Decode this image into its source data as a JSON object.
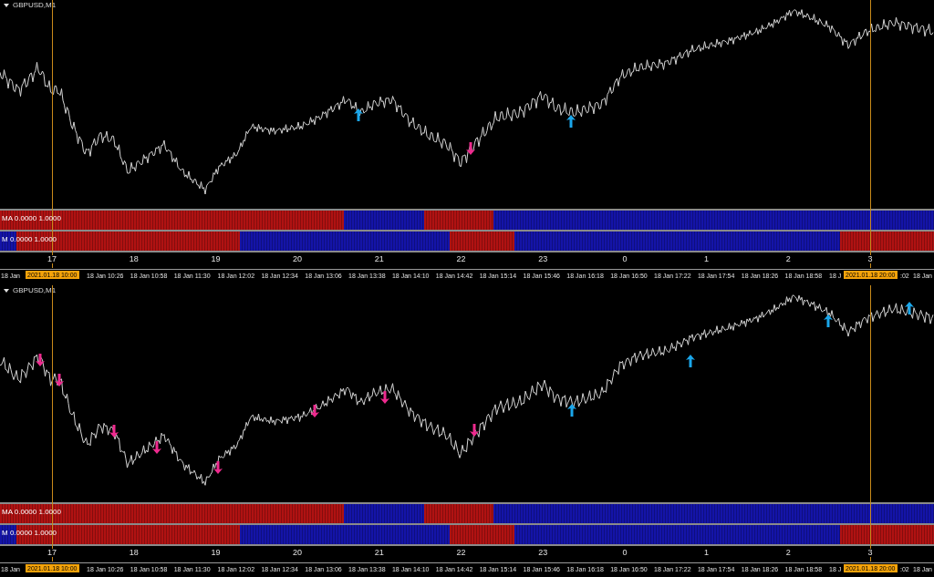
{
  "panels": [
    {
      "title": "GBPUSD,M1",
      "signals": [
        {
          "kind": "up"
        },
        {
          "kind": "down"
        },
        {
          "kind": "up"
        }
      ],
      "indicators": [
        {
          "label": "MA 0.0000 1.0000",
          "segments": [
            {
              "color": "#b01212"
            },
            {
              "color": "#1414a8"
            },
            {
              "color": "#b01212"
            },
            {
              "color": "#1414a8"
            }
          ]
        },
        {
          "label": "M 0.0000 1.0000",
          "segments": [
            {
              "color": "#1414a8"
            },
            {
              "color": "#b01212"
            },
            {
              "color": "#1414a8"
            },
            {
              "color": "#b01212"
            },
            {
              "color": "#1414a8"
            },
            {
              "color": "#b01212"
            }
          ]
        }
      ],
      "hour_labels": [
        "17",
        "18",
        "19",
        "20",
        "21",
        "22",
        "23",
        "0",
        "1",
        "2",
        "3"
      ],
      "time_labels": [
        "18 Jan",
        "18 Jan 10:26",
        "18 Jan 10:58",
        "18 Jan 11:30",
        "18 Jan 12:02",
        "18 Jan 12:34",
        "18 Jan 13:06",
        "18 Jan 13:38",
        "18 Jan 14:10",
        "18 Jan 14:42",
        "18 Jan 15:14",
        "18 Jan 15:46",
        "18 Jan 16:18",
        "18 Jan 16:50",
        "18 Jan 17:22",
        "18 Jan 17:54",
        "18 Jan 18:26",
        "18 Jan 18:58",
        "18 J",
        ":02",
        "18 Jan"
      ],
      "cursor_labels": [
        "2021.01.18 10:00",
        "2021.01.18 20:00"
      ]
    },
    {
      "title": "GBPUSD,M1",
      "signals": [
        {
          "kind": "down"
        },
        {
          "kind": "down"
        },
        {
          "kind": "down"
        },
        {
          "kind": "down"
        },
        {
          "kind": "down"
        },
        {
          "kind": "down"
        },
        {
          "kind": "down"
        },
        {
          "kind": "down"
        },
        {
          "kind": "up"
        },
        {
          "kind": "up"
        },
        {
          "kind": "up"
        },
        {
          "kind": "up"
        }
      ],
      "indicators": [
        {
          "label": "MA 0.0000 1.0000",
          "segments": [
            {
              "color": "#b01212"
            },
            {
              "color": "#1414a8"
            },
            {
              "color": "#b01212"
            },
            {
              "color": "#1414a8"
            }
          ]
        },
        {
          "label": "M 0.0000 1.0000",
          "segments": [
            {
              "color": "#1414a8"
            },
            {
              "color": "#b01212"
            },
            {
              "color": "#1414a8"
            },
            {
              "color": "#b01212"
            },
            {
              "color": "#1414a8"
            },
            {
              "color": "#b01212"
            }
          ]
        }
      ],
      "hour_labels": [
        "17",
        "18",
        "19",
        "20",
        "21",
        "22",
        "23",
        "0",
        "1",
        "2",
        "3"
      ],
      "time_labels": [
        "18 Jan",
        "18 Jan 10:26",
        "18 Jan 10:58",
        "18 Jan 11:30",
        "18 Jan 12:02",
        "18 Jan 12:34",
        "18 Jan 13:06",
        "18 Jan 13:38",
        "18 Jan 14:10",
        "18 Jan 14:42",
        "18 Jan 15:14",
        "18 Jan 15:46",
        "18 Jan 16:18",
        "18 Jan 16:50",
        "18 Jan 17:22",
        "18 Jan 17:54",
        "18 Jan 18:26",
        "18 Jan 18:58",
        "18 J",
        ":02",
        "18 Jan"
      ],
      "cursor_labels": [
        "2021.01.18 10:00",
        "2021.01.18 20:00"
      ]
    }
  ]
}
